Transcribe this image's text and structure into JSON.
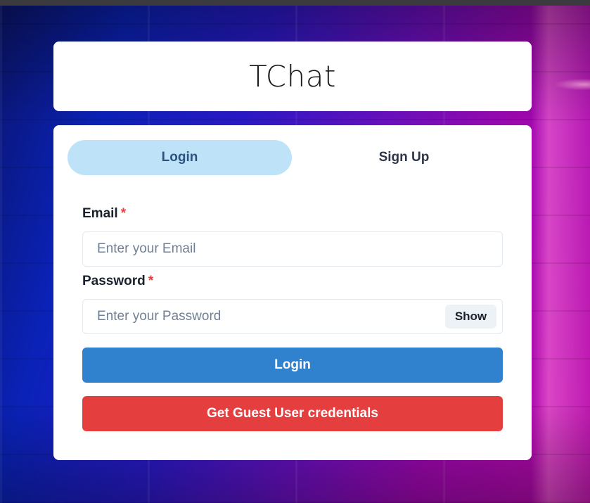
{
  "app": {
    "title": "TChat"
  },
  "tabs": [
    {
      "label": "Login",
      "active": true
    },
    {
      "label": "Sign Up",
      "active": false
    }
  ],
  "form": {
    "email": {
      "label": "Email",
      "required_mark": "*",
      "placeholder": "Enter your Email",
      "value": ""
    },
    "password": {
      "label": "Password",
      "required_mark": "*",
      "placeholder": "Enter your Password",
      "value": "",
      "toggle_label": "Show"
    },
    "login_button": "Login",
    "guest_button": "Get Guest User credentials"
  },
  "colors": {
    "active_tab_bg": "#bee3f8",
    "login_button": "#3182ce",
    "guest_button": "#e53e3e",
    "required_mark": "#e53e3e"
  }
}
